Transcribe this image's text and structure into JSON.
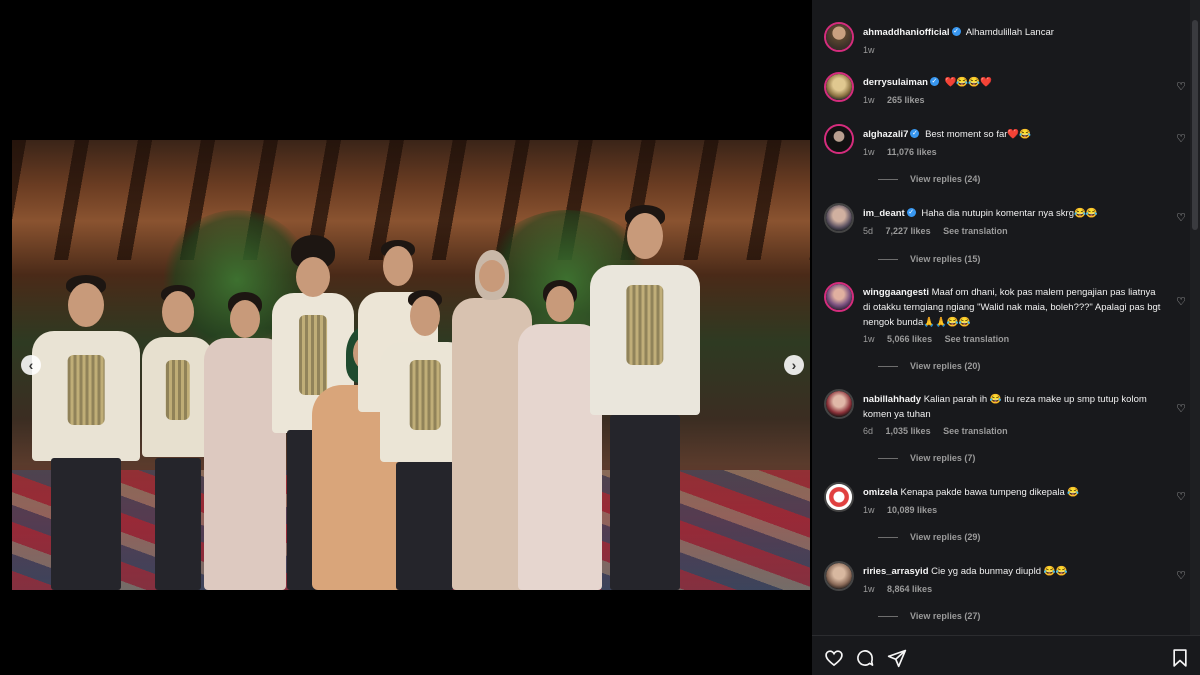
{
  "carousel": {
    "prev_symbol": "‹",
    "next_symbol": "›"
  },
  "comments": [
    {
      "username": "ahmaddhaniofficial",
      "verified": true,
      "text": "Alhamdulillah Lancar",
      "time": "1w",
      "likes": "",
      "reply_label": "",
      "translate_label": "",
      "view_replies": ""
    },
    {
      "username": "derrysulaiman",
      "verified": true,
      "text": "❤️😂😂❤️",
      "time": "1w",
      "likes": "265 likes",
      "reply_label": "",
      "translate_label": "",
      "view_replies": ""
    },
    {
      "username": "alghazali7",
      "verified": true,
      "text": "Best moment so far❤️😂",
      "time": "1w",
      "likes": "11,076 likes",
      "reply_label": "",
      "translate_label": "",
      "view_replies": "View replies (24)"
    },
    {
      "username": "im_deant",
      "verified": true,
      "text": "Haha dia nutupin komentar nya skrg😂😂",
      "time": "5d",
      "likes": "7,227 likes",
      "reply_label": "",
      "translate_label": "See translation",
      "view_replies": "View replies (15)"
    },
    {
      "username": "winggaangesti",
      "verified": false,
      "text": "Maaf om dhani, kok pas malem pengajian pas liatnya di otakku terngiang ngiang \"Walid nak maia, boleh???\" Apalagi pas bgt nengok bunda🙏🙏😂😂",
      "time": "1w",
      "likes": "5,066 likes",
      "reply_label": "",
      "translate_label": "See translation",
      "view_replies": "View replies (20)"
    },
    {
      "username": "nabillahhady",
      "verified": false,
      "text": "Kalian parah ih 😂 itu reza make up smp tutup kolom komen ya tuhan",
      "time": "6d",
      "likes": "1,035 likes",
      "reply_label": "",
      "translate_label": "See translation",
      "view_replies": "View replies (7)"
    },
    {
      "username": "omizela",
      "verified": false,
      "text": "Kenapa pakde bawa tumpeng dikepala 😂",
      "time": "1w",
      "likes": "10,089 likes",
      "reply_label": "",
      "translate_label": "",
      "view_replies": "View replies (29)"
    },
    {
      "username": "riries_arrasyid",
      "verified": false,
      "text": "Cie yg ada bunmay diupld 😂😂",
      "time": "1w",
      "likes": "8,864 likes",
      "reply_label": "",
      "translate_label": "",
      "view_replies": "View replies (27)"
    }
  ],
  "icons": {
    "like": "heart-icon",
    "comment": "comment-icon",
    "share": "share-icon",
    "save": "bookmark-icon"
  },
  "colors": {
    "panel_bg": "#18191c",
    "story_ring": "#d52c7d",
    "verified": "#3897f0",
    "muted_text": "#9a9a9a"
  }
}
